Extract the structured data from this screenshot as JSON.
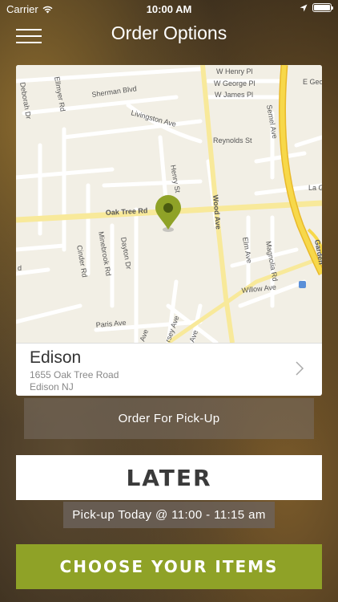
{
  "status_bar": {
    "carrier": "Carrier",
    "time": "10:00 AM"
  },
  "nav": {
    "title": "Order Options"
  },
  "map": {
    "streets": [
      "W Henry Pl",
      "W George Pl",
      "W James Pl",
      "E Geo",
      "Sherman Blvd",
      "Deborah Dr",
      "Ellmyer Rd",
      "Livingston Ave",
      "Reynolds St",
      "Semel Ave",
      "Henry St",
      "Wood Ave",
      "Oak Tree Rd",
      "La G",
      "Minebrook Rd",
      "Dayton Dr",
      "Cinder Rd",
      "Elm Ave",
      "Magnolia Rd",
      "Willow Ave",
      "Paris Ave",
      "d",
      "Garden",
      "Ave",
      "rsey Ave",
      "Ave"
    ],
    "colors": {
      "land": "#f2efe5",
      "road": "#ffffff",
      "highway": "#f7d84a",
      "pin": "#8fa227"
    }
  },
  "location": {
    "name": "Edison",
    "address_line1": "1655 Oak Tree Road",
    "address_line2": "Edison NJ"
  },
  "order_type": "Order For Pick-Up",
  "timing": {
    "later_label": "LATER",
    "pickup_text": "Pick-up Today @ 11:00 - 11:15 am"
  },
  "cta": {
    "choose_label": "CHOOSE YOUR ITEMS"
  },
  "colors": {
    "accent": "#8fa227"
  }
}
